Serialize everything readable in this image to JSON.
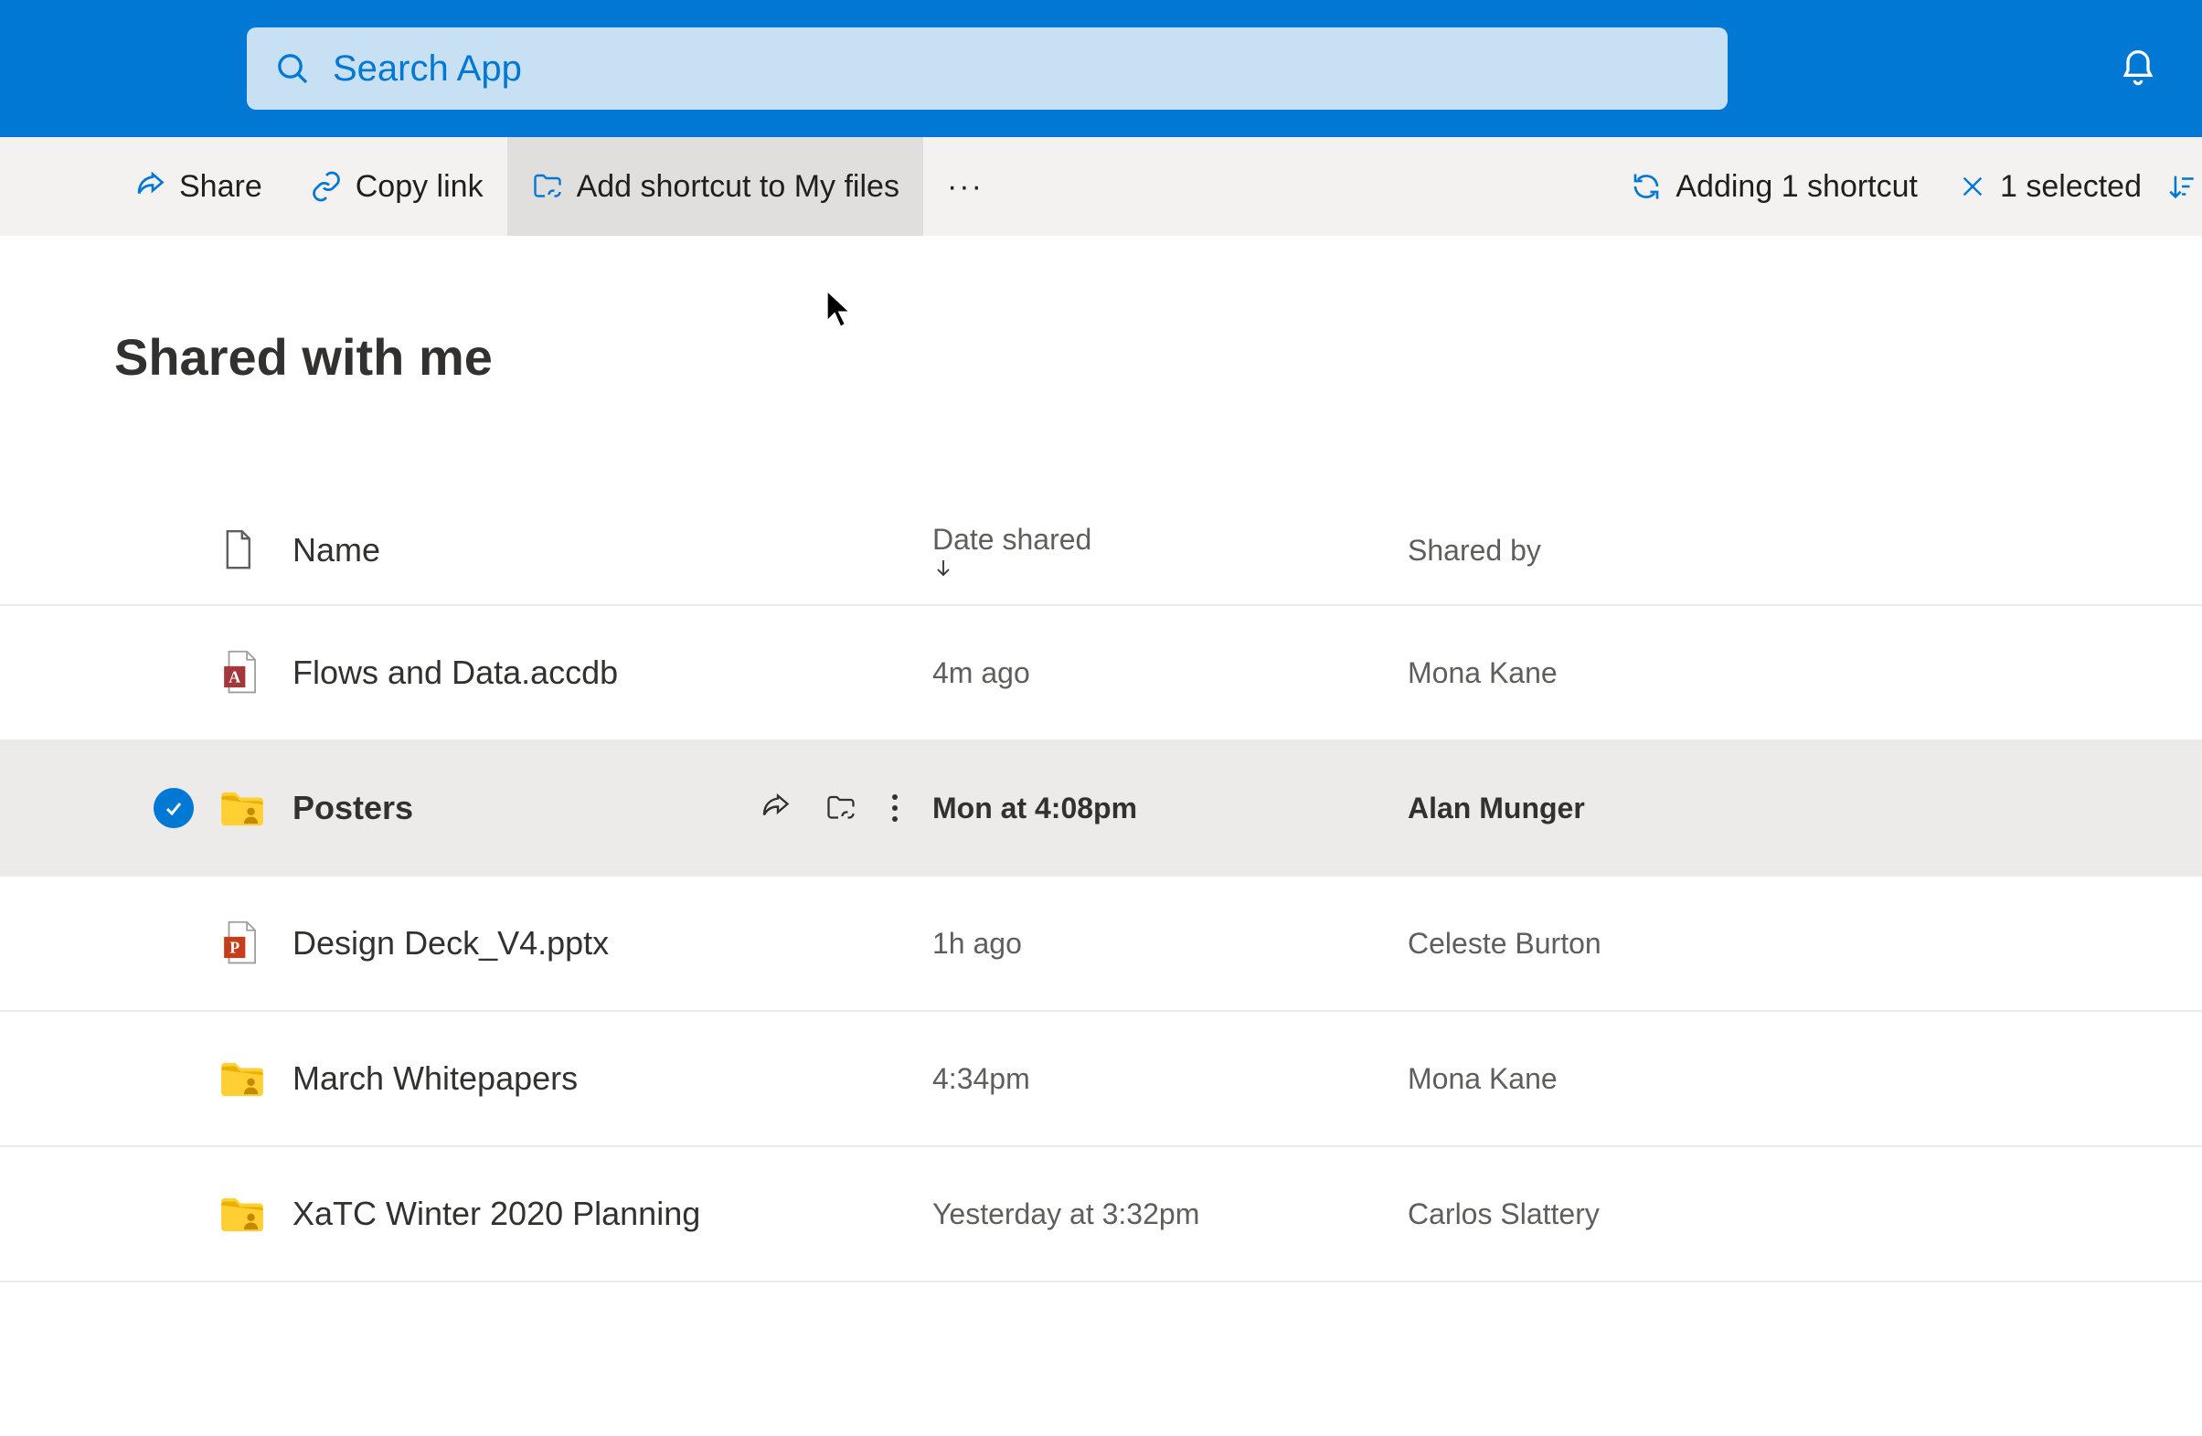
{
  "header": {
    "search_placeholder": "Search App"
  },
  "cmdbar": {
    "share": "Share",
    "copy_link": "Copy link",
    "add_shortcut": "Add shortcut to My files",
    "more": "···",
    "adding_shortcut": "Adding 1 shortcut",
    "selected": "1 selected"
  },
  "page": {
    "title": "Shared with me"
  },
  "columns": {
    "name": "Name",
    "date": "Date shared",
    "shared_by": "Shared by"
  },
  "rows": [
    {
      "icon": "access",
      "name": "Flows and Data.accdb",
      "date": "4m ago",
      "shared_by": "Mona Kane",
      "selected": false
    },
    {
      "icon": "folder-user",
      "name": "Posters",
      "date": "Mon at 4:08pm",
      "shared_by": "Alan Munger",
      "selected": true
    },
    {
      "icon": "powerpoint",
      "name": "Design Deck_V4.pptx",
      "date": "1h ago",
      "shared_by": "Celeste Burton",
      "selected": false
    },
    {
      "icon": "folder-user",
      "name": "March Whitepapers",
      "date": "4:34pm",
      "shared_by": "Mona Kane",
      "selected": false
    },
    {
      "icon": "folder-user",
      "name": "XaTC Winter 2020 Planning",
      "date": "Yesterday at 3:32pm",
      "shared_by": "Carlos Slattery",
      "selected": false
    }
  ]
}
